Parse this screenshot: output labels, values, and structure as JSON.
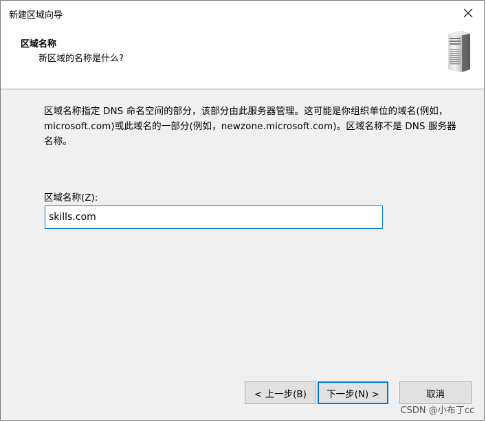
{
  "window": {
    "title": "新建区域向导",
    "close_symbol": "✕"
  },
  "header": {
    "title": "区域名称",
    "subtitle": "新区域的名称是什么?",
    "icon": "server-icon"
  },
  "main": {
    "description": "区域名称指定 DNS 命名空间的部分，该部分由此服务器管理。这可能是你组织单位的域名(例如，microsoft.com)或此域名的一部分(例如，newzone.microsoft.com)。区域名称不是 DNS 服务器名称。",
    "zone_name_label": "区域名称(Z):",
    "zone_name_value": "skills.com"
  },
  "buttons": {
    "back": "< 上一步(B)",
    "next": "下一步(N) >",
    "cancel": "取消"
  },
  "watermark": "CSDN @小布丁cc",
  "colors": {
    "focus_border": "#0078d7",
    "button_bg": "#e1e1e1",
    "dialog_bg": "#f0f0f0"
  }
}
